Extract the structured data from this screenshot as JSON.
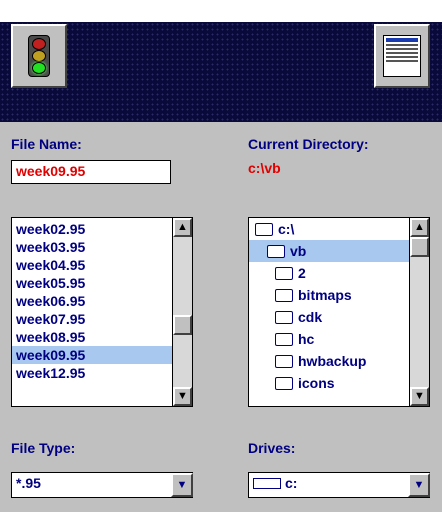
{
  "toolbar": {
    "left_icon": "traffic-light-icon",
    "right_icon": "list-view-icon"
  },
  "file_name": {
    "label": "File Name:",
    "value": "week09.95"
  },
  "current_directory": {
    "label": "Current Directory:",
    "value": "c:\\vb"
  },
  "files": {
    "items": [
      "week02.95",
      "week03.95",
      "week04.95",
      "week05.95",
      "week06.95",
      "week07.95",
      "week08.95",
      "week09.95",
      "week12.95"
    ],
    "selected": "week09.95",
    "scroll_position": 0.6
  },
  "directories": {
    "items": [
      "c:\\",
      "vb",
      "2",
      "bitmaps",
      "cdk",
      "hc",
      "hwbackup",
      "icons"
    ],
    "selected": "vb",
    "scroll_position": 0.0
  },
  "file_type": {
    "label": "File Type:",
    "value": "*.95"
  },
  "drives": {
    "label": "Drives:",
    "value": "c:"
  }
}
